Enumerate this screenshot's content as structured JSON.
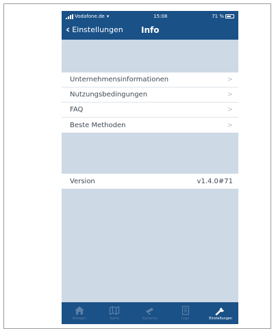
{
  "status_bar": {
    "carrier": "Vodafone.de",
    "time": "15:08",
    "battery": "71 %",
    "battery_level": 0.71
  },
  "nav": {
    "back_label": "Einstellungen",
    "title": "Info"
  },
  "menu_items": [
    {
      "label": "Unternehmensinformationen"
    },
    {
      "label": "Nutzungsbedingungen"
    },
    {
      "label": "FAQ"
    },
    {
      "label": "Beste Methoden"
    }
  ],
  "version": {
    "label": "Version",
    "value": "v1.4.0#71"
  },
  "tabs": [
    {
      "label": "Anlagen",
      "icon": "home-icon"
    },
    {
      "label": "Karte",
      "icon": "map-icon"
    },
    {
      "label": "Kameras",
      "icon": "camera-icon"
    },
    {
      "label": "Logs",
      "icon": "list-icon"
    },
    {
      "label": "Einstellungen",
      "icon": "wrench-icon",
      "active": true
    }
  ],
  "colors": {
    "brand": "#1a5187",
    "background": "#cdd9e5",
    "tab_inactive": "#5b7fa6"
  }
}
